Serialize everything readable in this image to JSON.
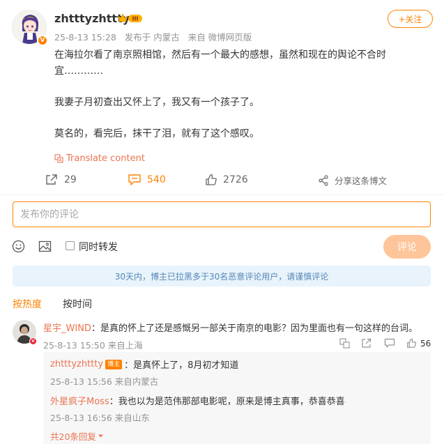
{
  "post": {
    "username": "zhtttyzhttty",
    "level_badge": "III",
    "avatar_icon": "anime-avatar",
    "verified_badge": "V",
    "meta": {
      "time": "25-8-13 15:28",
      "location": "发布于 内蒙古",
      "source": "来自 微博网页版"
    },
    "follow_label": "+关注",
    "paragraphs": [
      "在海拉尔看了南京照相馆，然后有一个最大的感想，虽然和现在的舆论不合时宜…………",
      "我妻子月初查出又怀上了，我又有一个孩子了。",
      "莫名的，看完后，抹干了泪，就有了这个感叹。"
    ],
    "translate_label": "Translate content",
    "actions": {
      "repost_count": "29",
      "comment_count": "540",
      "like_count": "2726",
      "share_label": "分享这条博文"
    }
  },
  "comment_box": {
    "placeholder": "发布你的评论",
    "repost_label": "同时转发",
    "submit_label": "评论"
  },
  "notice": "30天内，博主已拉黑多于30名恶意评论用户，请谨慎评论",
  "sort": {
    "hot": "按热度",
    "time": "按时间"
  },
  "comments": [
    {
      "nick": "星宇_WIND",
      "text": "：是真的怀上了还是感慨另一部关于南京的电影？因为里面也有一句这样的台词。",
      "time": "25-8-13 15:50",
      "location": "来自上海",
      "likes": "56",
      "replies": [
        {
          "nick": "zhtttyzhttty",
          "tag": "博主",
          "text": "：是真怀上了，8月初才知道",
          "time": "25-8-13 15:56",
          "location": "来自内蒙古"
        },
        {
          "nick": "外星疯子Moss",
          "text": "：我也以为是范伟那部电影呢，原来是博主真事，恭喜恭喜",
          "time": "25-8-13 16:56",
          "location": "来自山东"
        }
      ],
      "more_replies": "共20条回复"
    }
  ],
  "colors": {
    "accent": "#ff8200",
    "link": "#eb7350",
    "notice_bg": "#e8f3fc",
    "notice_text": "#5587b5"
  }
}
